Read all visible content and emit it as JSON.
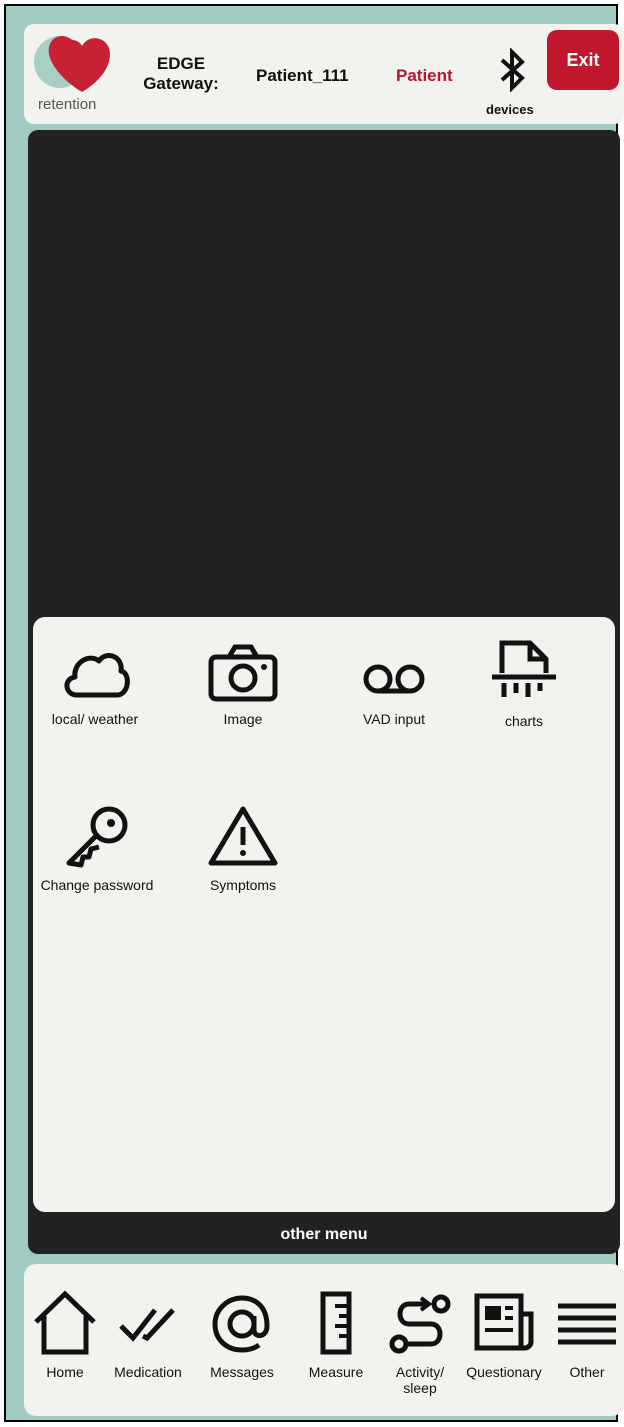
{
  "header": {
    "logo_text": "retention",
    "gateway_label": "EDGE Gateway:",
    "patient_id": "Patient_111",
    "role": "Patient",
    "devices_label": "devices",
    "exit_label": "Exit"
  },
  "panel": {
    "tiles": [
      {
        "label": "local/ weather",
        "icon": "cloud-icon"
      },
      {
        "label": "Image",
        "icon": "camera-icon"
      },
      {
        "label": "VAD input",
        "icon": "voicemail-icon"
      },
      {
        "label": "charts",
        "icon": "shredder-icon"
      },
      {
        "label": "Change password",
        "icon": "key-icon"
      },
      {
        "label": "Symptoms",
        "icon": "warning-icon"
      }
    ],
    "footer_label": "other menu"
  },
  "bottom_nav": {
    "items": [
      {
        "label": "Home",
        "icon": "home-icon"
      },
      {
        "label": "Medication",
        "icon": "double-check-icon"
      },
      {
        "label": "Messages",
        "icon": "at-icon"
      },
      {
        "label": "Measure",
        "icon": "ruler-icon"
      },
      {
        "label": "Activity/ sleep",
        "icon": "route-icon"
      },
      {
        "label": "Questionary",
        "icon": "newspaper-icon"
      },
      {
        "label": "Other",
        "icon": "menu-icon"
      }
    ]
  },
  "colors": {
    "accent": "#c0172c",
    "background": "#9fcbc2",
    "panel": "#f2f2ee",
    "dark": "#222222"
  }
}
